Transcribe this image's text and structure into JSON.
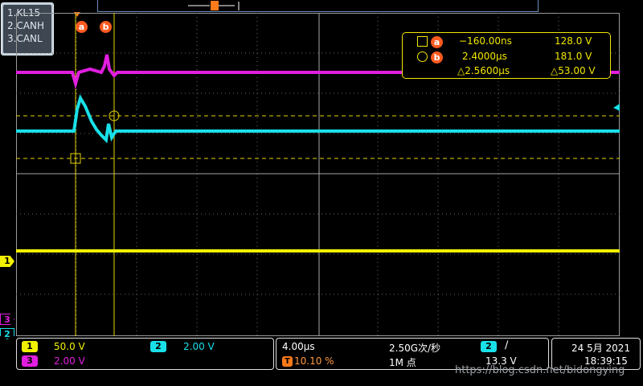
{
  "channels": {
    "names": [
      "1.KL15",
      "2.CANH",
      "3.CANL"
    ]
  },
  "cursors": {
    "a_label": "a",
    "b_label": "b",
    "a_time": "−160.00ns",
    "a_volt": "128.0 V",
    "b_time": "2.4000µs",
    "b_volt": "181.0 V",
    "delta_time": "△2.5600µs",
    "delta_volt": "△53.00 V"
  },
  "markers": {
    "ch1": "1",
    "ch2": "2",
    "ch3": "3",
    "trigger": "T"
  },
  "status": {
    "ch1_num": "1",
    "ch1_scale": "50.0 V",
    "ch2_num": "2",
    "ch2_scale": "2.00 V",
    "ch3_num": "3",
    "ch3_scale": "2.00 V",
    "timebase": "4.00µs",
    "sample_rate": "2.50G次/秒",
    "trig_pos": "10.10 %",
    "memory": "1M 点",
    "trig_chan": "2",
    "trig_slope": "∕",
    "trig_level": "13.3 V",
    "date": "24 5月 2021",
    "time": "18:39:15"
  },
  "watermark": "https://blog.csdn.net/bidongying",
  "colors": {
    "ch1": "#f2f200",
    "ch2": "#19e0e8",
    "ch3": "#e21ee0",
    "cursor": "#f2e600",
    "accent": "#ff5a1f"
  }
}
